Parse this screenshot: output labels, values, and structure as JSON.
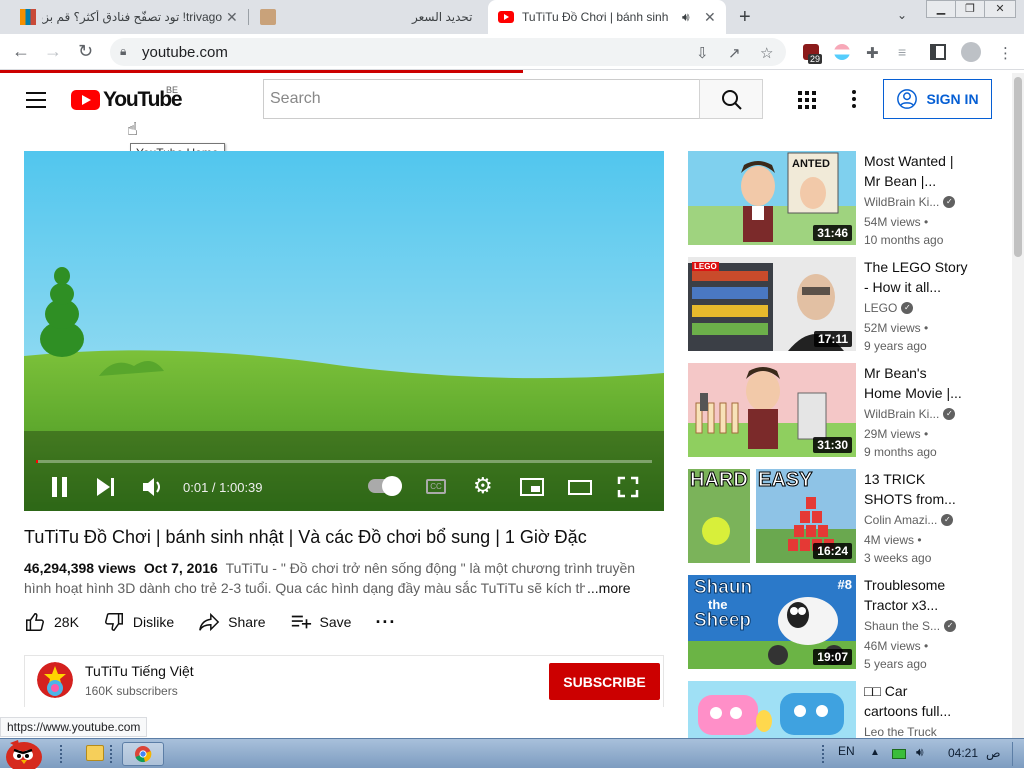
{
  "browser": {
    "tabs": [
      {
        "title": "trivago! تود تصفّح فنادق أكثر؟ قم بزيارة",
        "active": false
      },
      {
        "title": "تحديد السعر",
        "active": false
      },
      {
        "title": "TuTiTu Đồ Chơi | bánh sinh",
        "active": true
      }
    ],
    "url": "youtube.com",
    "extension_badge": "29",
    "status_url": "https://www.youtube.com"
  },
  "masthead": {
    "logo_text": "YouTube",
    "country_code": "BE",
    "logo_tooltip": "YouTube Home",
    "search_placeholder": "Search",
    "sign_in_label": "SIGN IN"
  },
  "player": {
    "time_display": "0:01 / 1:00:39",
    "progress_fraction": 0.0003
  },
  "video": {
    "title": "TuTiTu Đồ Chơi | bánh sinh nhật | Và các Đồ chơi bổ sung | 1 Giờ Đặc",
    "views": "46,294,398 views",
    "date": "Oct 7, 2016",
    "description_line1": "TuTiTu - \" Đồ chơi trở nên sống động \" là một chương trình truyền",
    "description_line2": "hình hoạt hình 3D dành cho trẻ 2-3 tuổi. Qua các hình dạng đầy màu sắc TuTiTu sẽ kích th",
    "more_label": "...more",
    "likes": "28K",
    "dislike_label": "Dislike",
    "share_label": "Share",
    "save_label": "Save"
  },
  "channel": {
    "name": "TuTiTu Tiếng Việt",
    "subscribers": "160K subscribers",
    "subscribe_label": "SUBSCRIBE"
  },
  "recommendations": [
    {
      "title_l1": "Most Wanted |",
      "title_l2": "Mr Bean |...",
      "channel": "WildBrain Ki...",
      "verified": true,
      "views": "54M views •",
      "age": "10 months ago",
      "duration": "31:46"
    },
    {
      "title_l1": "The LEGO Story",
      "title_l2": "- How it all...",
      "channel": "LEGO",
      "verified": true,
      "views": "52M views •",
      "age": "9 years ago",
      "duration": "17:11"
    },
    {
      "title_l1": "Mr Bean's",
      "title_l2": "Home Movie |...",
      "channel": "WildBrain Ki...",
      "verified": true,
      "views": "29M views •",
      "age": "9 months ago",
      "duration": "31:30"
    },
    {
      "title_l1": "13 TRICK",
      "title_l2": "SHOTS from...",
      "channel": "Colin Amazi...",
      "verified": true,
      "views": "4M views •",
      "age": "3 weeks ago",
      "duration": "16:24"
    },
    {
      "title_l1": "Troublesome",
      "title_l2": "Tractor x3...",
      "channel": "Shaun the S...",
      "verified": true,
      "views": "46M views •",
      "age": "5 years ago",
      "duration": "19:07"
    },
    {
      "title_l1": "□□ Car",
      "title_l2": "cartoons full...",
      "channel": "Leo the Truck",
      "verified": false,
      "views": "",
      "age": "",
      "duration": ""
    }
  ],
  "thumb_text": {
    "wanted": "ANTED",
    "lego": "LEGO",
    "hard": "HARD",
    "easy": "EASY",
    "shaun_l1": "Shaun",
    "shaun_l2": "the",
    "shaun_l3": "Sheep",
    "shaun_num": "#8"
  },
  "taskbar": {
    "language": "EN",
    "time": "04:21",
    "ampm": "ص"
  },
  "colors": {
    "youtube_red": "#ff0000",
    "subscribe_red": "#cc0000",
    "link_blue": "#065fd4",
    "sky": "#5ec8ea",
    "grass": "#55a82a"
  }
}
